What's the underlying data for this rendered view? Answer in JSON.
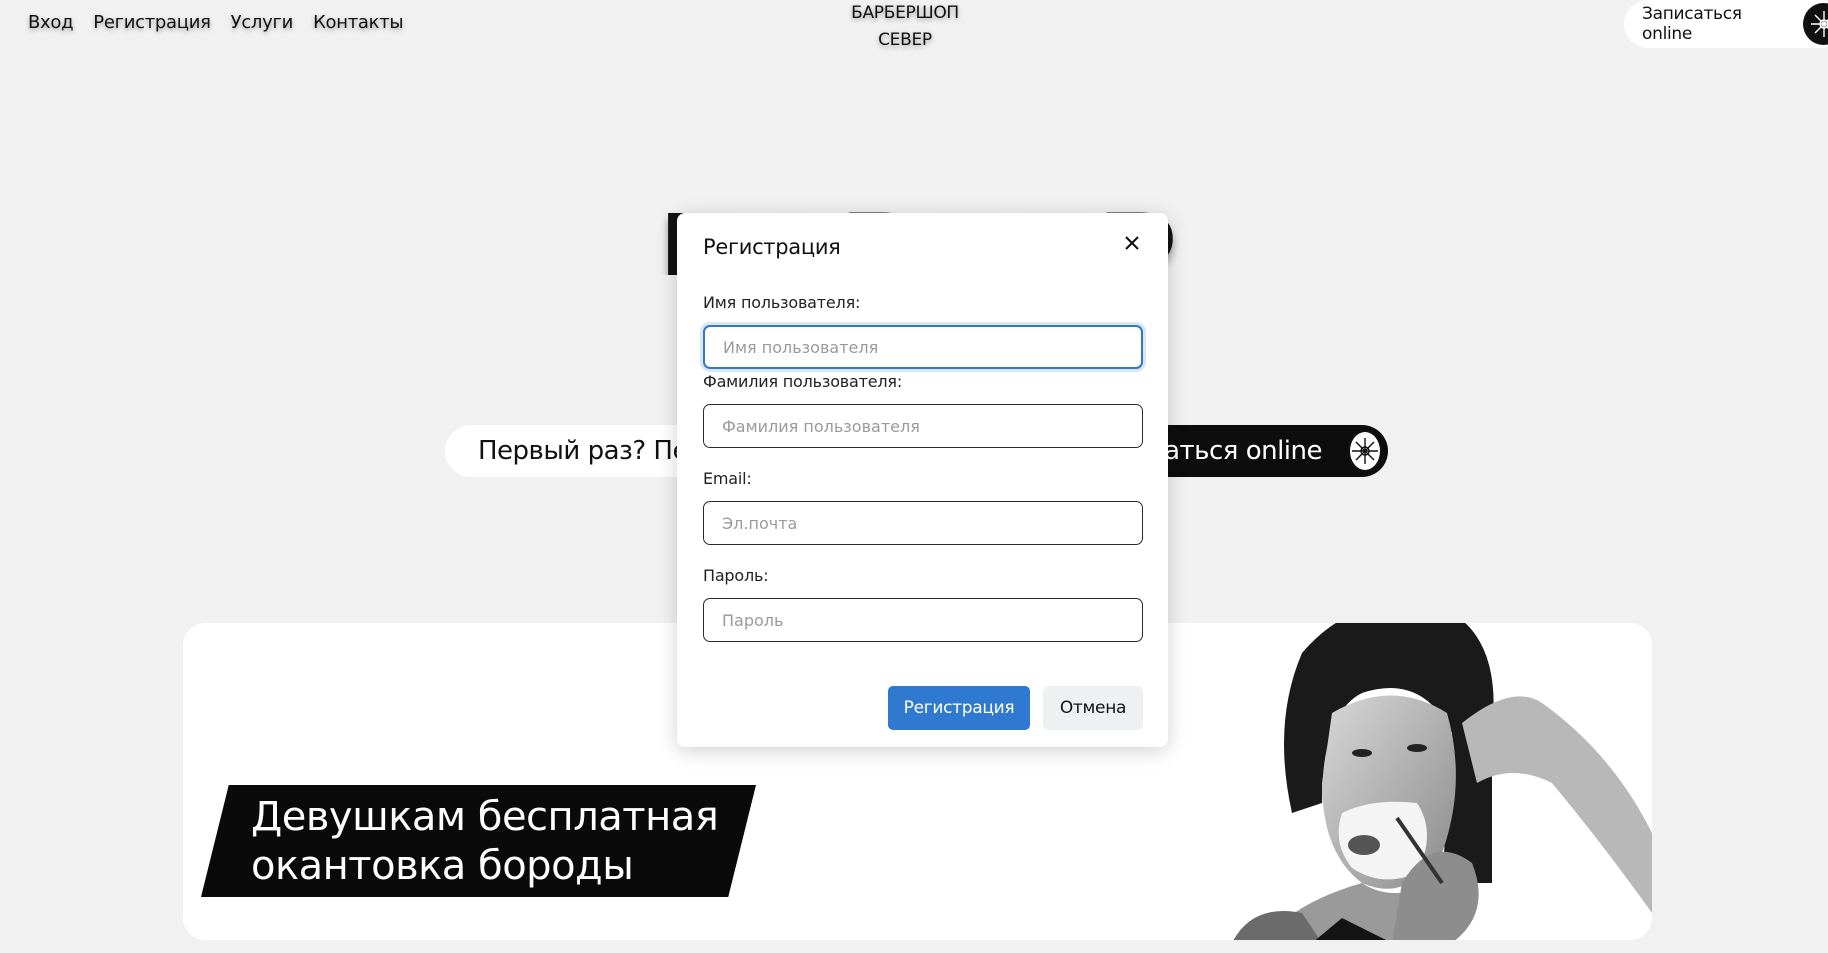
{
  "nav": {
    "items": [
      {
        "label": "Вход"
      },
      {
        "label": "Регистрация"
      },
      {
        "label": "Услуги"
      },
      {
        "label": "Контакты"
      }
    ]
  },
  "brand": {
    "line1": "БАРБЕРШОП",
    "line2": "СЕВЕР"
  },
  "header_book": {
    "label": "Записаться online",
    "icon": "compass-icon"
  },
  "hero": {
    "title": "БАРБЕРШОП",
    "first_time_text": "Первый раз? Первая стрижка со скидкой",
    "book_label": "Записаться online",
    "book_icon": "compass-icon"
  },
  "promo": {
    "line1": "Девушкам бесплатная",
    "line2": "окантовка бороды",
    "photo": "woman-shaving-photo"
  },
  "modal": {
    "title": "Регистрация",
    "close_icon": "close-icon",
    "fields": {
      "username": {
        "label": "Имя пользователя:",
        "placeholder": "Имя пользователя",
        "value": ""
      },
      "surname": {
        "label": "Фамилия пользователя:",
        "placeholder": "Фамилия пользователя",
        "value": ""
      },
      "email": {
        "label": "Email:",
        "placeholder": "Эл.почта",
        "value": ""
      },
      "password": {
        "label": "Пароль:",
        "placeholder": "Пароль",
        "value": ""
      }
    },
    "submit_label": "Регистрация",
    "cancel_label": "Отмена"
  },
  "colors": {
    "background": "#f1f1f1",
    "primary_button": "#2f79d0",
    "focus_border": "#2f79c9",
    "dark": "#0a0a0a"
  }
}
